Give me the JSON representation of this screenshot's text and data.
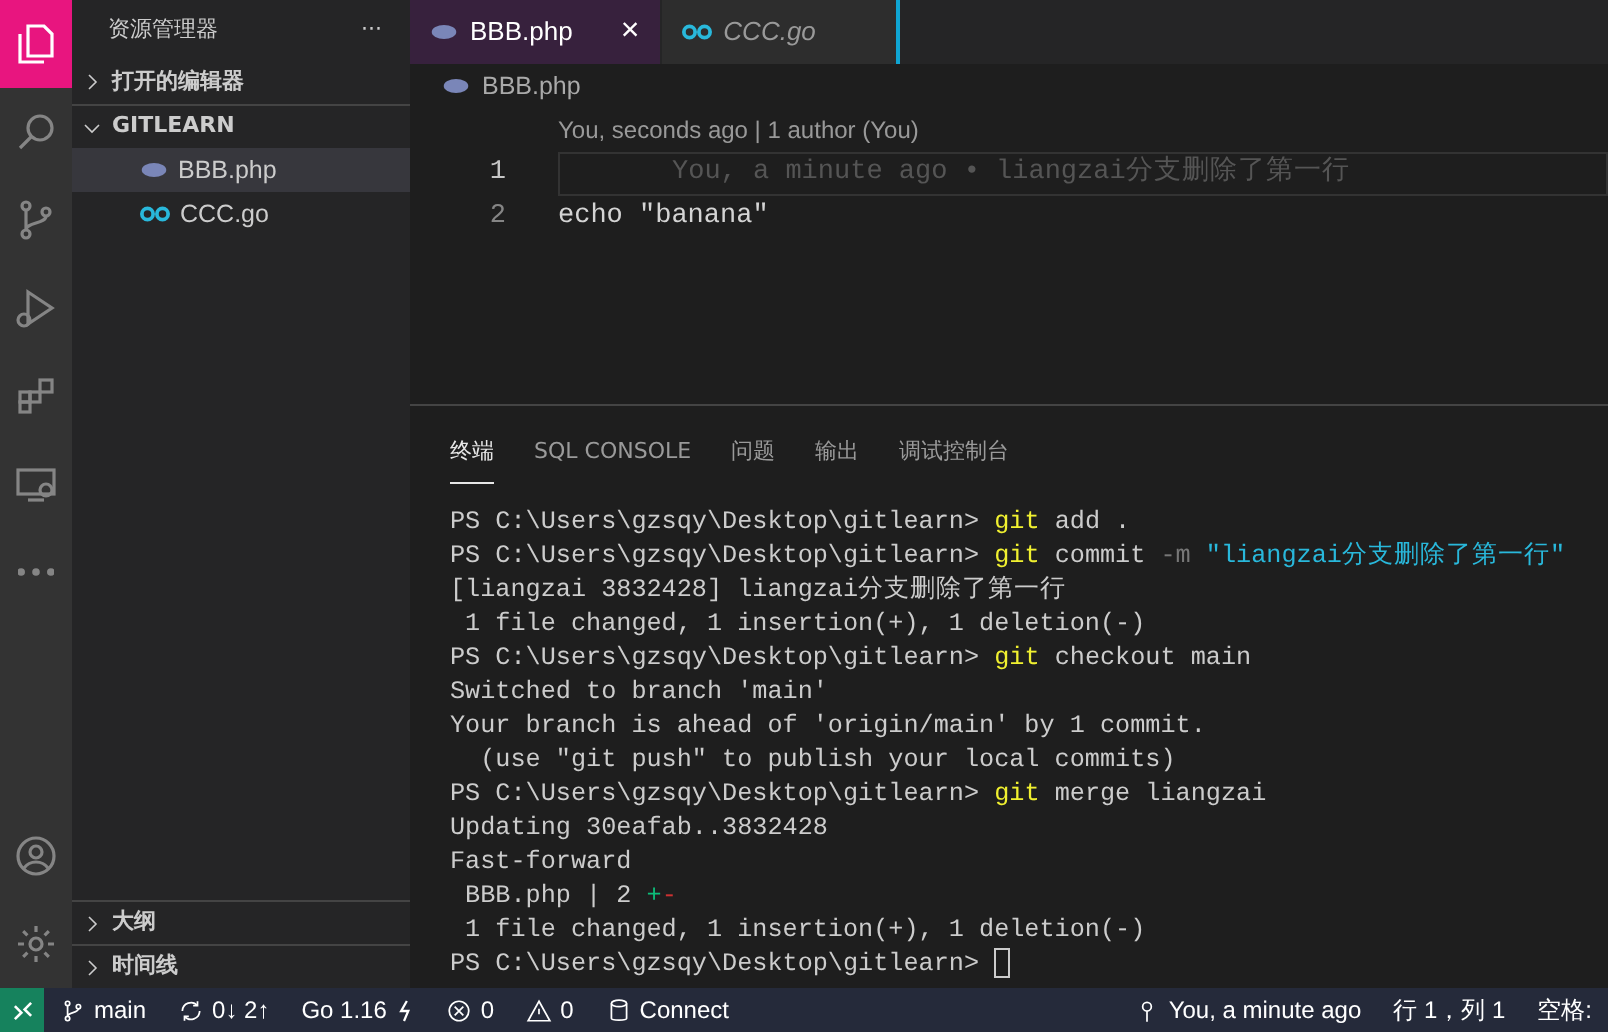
{
  "activity_bar": {
    "items": [
      {
        "kind": "files",
        "selected": true
      },
      {
        "kind": "search",
        "selected": false
      },
      {
        "kind": "scm",
        "selected": false
      },
      {
        "kind": "run",
        "selected": false
      },
      {
        "kind": "extensions",
        "selected": false
      },
      {
        "kind": "remote",
        "selected": false
      },
      {
        "kind": "more",
        "selected": false
      }
    ],
    "bottom": [
      {
        "kind": "account"
      },
      {
        "kind": "settings"
      }
    ]
  },
  "sidebar": {
    "title": "资源管理器",
    "more": "···",
    "sections": [
      {
        "label": "打开的编辑器",
        "expanded": false
      },
      {
        "label": "GITLEARN",
        "expanded": true,
        "files": [
          {
            "name": "BBB.php",
            "kind": "php",
            "selected": true
          },
          {
            "name": "CCC.go",
            "kind": "go",
            "selected": false
          }
        ]
      }
    ],
    "bottom_sections": [
      {
        "label": "大纲",
        "expanded": false
      },
      {
        "label": "时间线",
        "expanded": false
      }
    ]
  },
  "editor": {
    "tabs": [
      {
        "label": "BBB.php",
        "kind": "php",
        "selected": true,
        "close": "×"
      },
      {
        "label": "CCC.go",
        "kind": "go",
        "selected": false
      }
    ],
    "breadcrumb": {
      "label": "BBB.php",
      "kind": "php"
    },
    "codelens": "You, seconds ago | 1 author (You)",
    "lines": [
      {
        "number": "1",
        "blame": "You, a minute ago • liangzai分支删除了第一行",
        "current": true
      },
      {
        "number": "2",
        "text": "echo \"banana\"",
        "current": false
      }
    ]
  },
  "panel": {
    "tabs": [
      {
        "label": "终端",
        "selected": true
      },
      {
        "label": "SQL CONSOLE",
        "selected": false
      },
      {
        "label": "问题",
        "selected": false
      },
      {
        "label": "输出",
        "selected": false
      },
      {
        "label": "调试控制台",
        "selected": false
      }
    ],
    "terminal": [
      [
        {
          "kind": "plain",
          "text": "PS C:\\Users\\gzsqy\\Desktop\\gitlearn> "
        },
        {
          "kind": "command",
          "text": "git"
        },
        {
          "kind": "plain",
          "text": " add ."
        }
      ],
      [
        {
          "kind": "plain",
          "text": "PS C:\\Users\\gzsqy\\Desktop\\gitlearn> "
        },
        {
          "kind": "command",
          "text": "git"
        },
        {
          "kind": "plain",
          "text": " commit "
        },
        {
          "kind": "flag",
          "text": "-m "
        },
        {
          "kind": "string",
          "text": "\"liangzai分支删除了第一行\""
        }
      ],
      [
        {
          "kind": "plain",
          "text": "[liangzai 3832428] liangzai分支删除了第一行"
        }
      ],
      [
        {
          "kind": "plain",
          "text": " 1 file changed, 1 insertion(+), 1 deletion(-)"
        }
      ],
      [
        {
          "kind": "plain",
          "text": "PS C:\\Users\\gzsqy\\Desktop\\gitlearn> "
        },
        {
          "kind": "command",
          "text": "git"
        },
        {
          "kind": "plain",
          "text": " checkout main"
        }
      ],
      [
        {
          "kind": "plain",
          "text": "Switched to branch 'main'"
        }
      ],
      [
        {
          "kind": "plain",
          "text": "Your branch is ahead of 'origin/main' by 1 commit."
        }
      ],
      [
        {
          "kind": "plain",
          "text": "  (use \"git push\" to publish your local commits)"
        }
      ],
      [
        {
          "kind": "plain",
          "text": "PS C:\\Users\\gzsqy\\Desktop\\gitlearn> "
        },
        {
          "kind": "command",
          "text": "git"
        },
        {
          "kind": "plain",
          "text": " merge liangzai"
        }
      ],
      [
        {
          "kind": "plain",
          "text": "Updating 30eafab..3832428"
        }
      ],
      [
        {
          "kind": "plain",
          "text": "Fast-forward"
        }
      ],
      [
        {
          "kind": "plain",
          "text": " BBB.php | 2 "
        },
        {
          "kind": "added",
          "text": "+"
        },
        {
          "kind": "removed",
          "text": "-"
        }
      ],
      [
        {
          "kind": "plain",
          "text": " 1 file changed, 1 insertion(+), 1 deletion(-)"
        }
      ],
      [
        {
          "kind": "plain",
          "text": "PS C:\\Users\\gzsqy\\Desktop\\gitlearn> "
        },
        {
          "kind": "cursor"
        }
      ]
    ]
  },
  "status_bar": {
    "left": [
      {
        "kind": "remote"
      },
      {
        "kind": "branch",
        "text": "main"
      },
      {
        "kind": "sync",
        "text": "0↓ 2↑"
      },
      {
        "kind": "go",
        "text": "Go 1.16"
      },
      {
        "kind": "errors",
        "text": "0"
      },
      {
        "kind": "warnings",
        "text": "0"
      },
      {
        "kind": "db",
        "text": "Connect"
      }
    ],
    "right": [
      {
        "kind": "blame",
        "text": "You, a minute ago"
      },
      {
        "kind": "plain",
        "text": "行 1，列 1"
      },
      {
        "kind": "plain",
        "text": "空格:"
      }
    ]
  }
}
